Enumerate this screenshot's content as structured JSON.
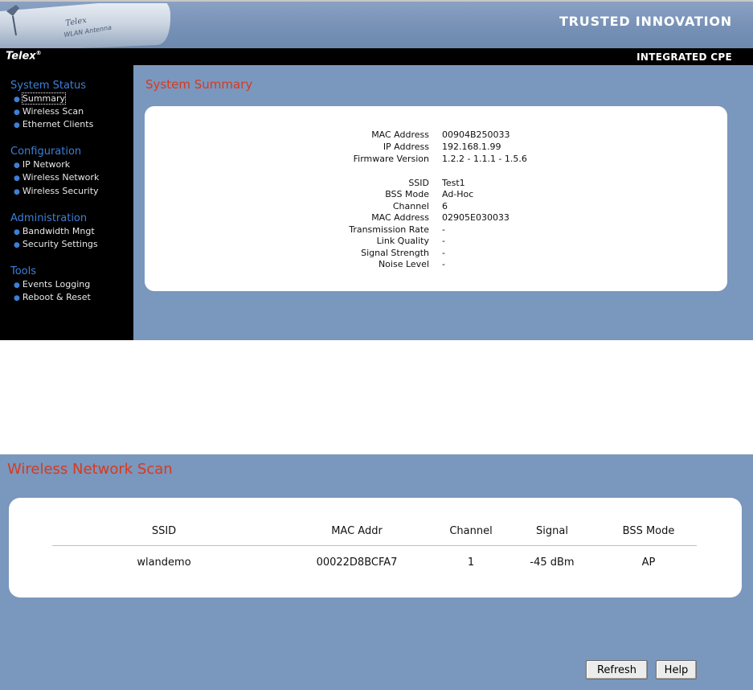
{
  "header": {
    "tagline": "TRUSTED INNOVATION",
    "brand": "Telex",
    "brand_mark": "®",
    "product": "INTEGRATED CPE",
    "antenna_brand": "Telex",
    "antenna_caption": "WLAN Antenna"
  },
  "sidebar": {
    "sections": [
      {
        "heading": "System Status",
        "items": [
          "Summary",
          "Wireless Scan",
          "Ethernet Clients"
        ]
      },
      {
        "heading": "Configuration",
        "items": [
          "IP Network",
          "Wireless Network",
          "Wireless Security"
        ]
      },
      {
        "heading": "Administration",
        "items": [
          "Bandwidth Mngt",
          "Security Settings"
        ]
      },
      {
        "heading": "Tools",
        "items": [
          "Events Logging",
          "Reboot & Reset"
        ]
      }
    ]
  },
  "summary": {
    "title": "System Summary",
    "rows": [
      {
        "label": "MAC Address",
        "value": "00904B250033"
      },
      {
        "label": "IP Address",
        "value": "192.168.1.99"
      },
      {
        "label": "Firmware Version",
        "value": "1.2.2 - 1.1.1 - 1.5.6"
      },
      {
        "label": "SSID",
        "value": "Test1"
      },
      {
        "label": "BSS Mode",
        "value": "Ad-Hoc"
      },
      {
        "label": "Channel",
        "value": "6"
      },
      {
        "label": "MAC Address",
        "value": "02905E030033"
      },
      {
        "label": "Transmission Rate",
        "value": "-"
      },
      {
        "label": "Link Quality",
        "value": "-"
      },
      {
        "label": "Signal Strength",
        "value": "-"
      },
      {
        "label": "Noise Level",
        "value": "-"
      }
    ]
  },
  "scan": {
    "title": "Wireless Network Scan",
    "columns": [
      "SSID",
      "MAC Addr",
      "Channel",
      "Signal",
      "BSS Mode"
    ],
    "rows": [
      [
        "wlandemo",
        "00022D8BCFA7",
        "1",
        "-45 dBm",
        "AP"
      ]
    ],
    "refresh_label": "Refresh",
    "help_label": "Help"
  },
  "colors": {
    "accent_title": "#d63a1f",
    "nav_heading": "#3d7fd6",
    "page_background": "#7a97bd"
  }
}
